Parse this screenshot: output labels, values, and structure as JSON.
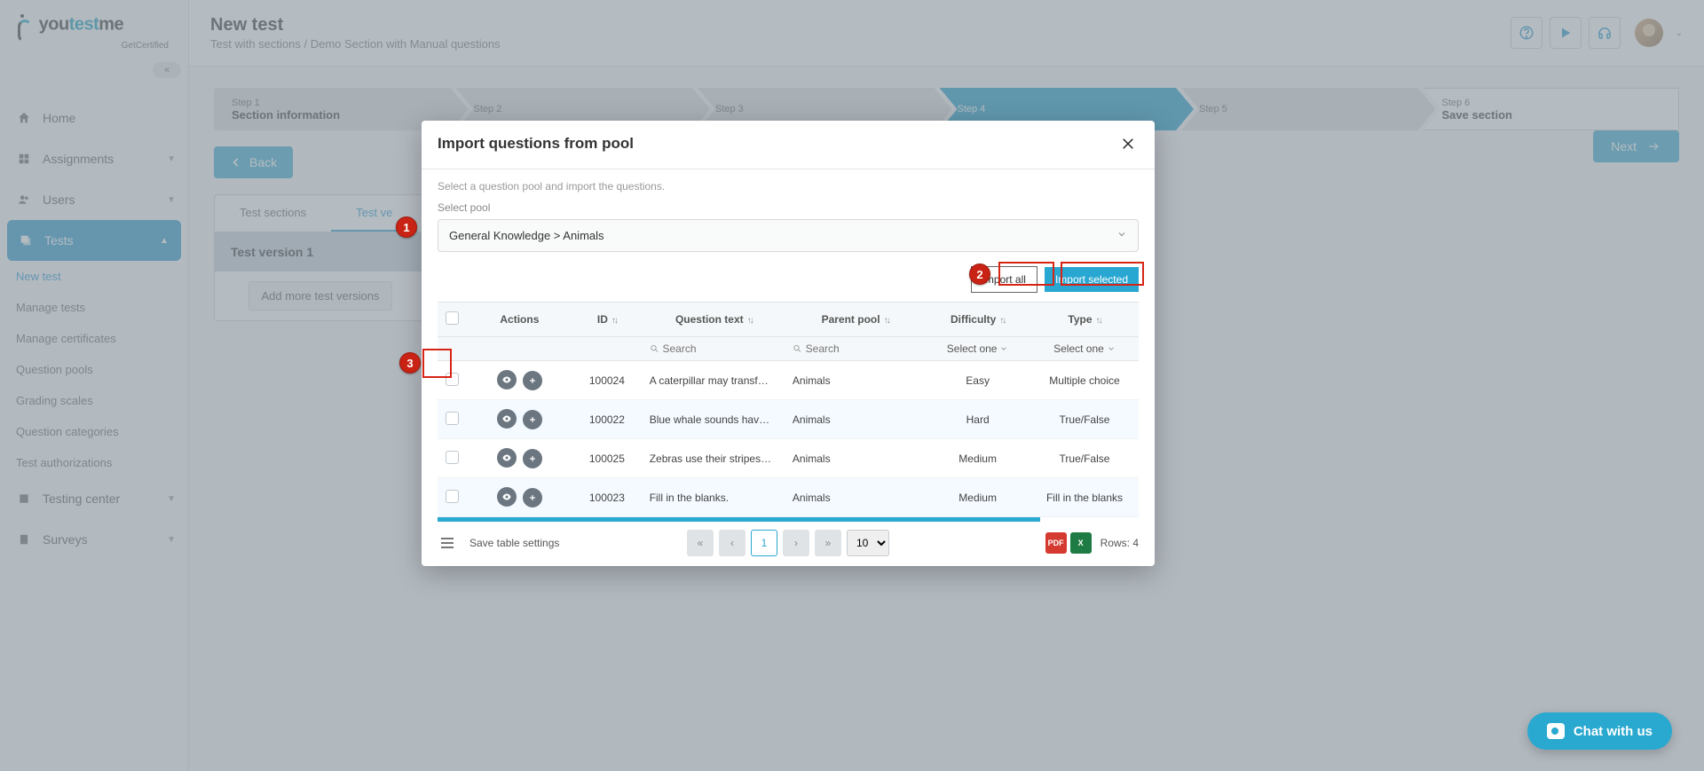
{
  "brand": {
    "prefix": "you",
    "mid": "test",
    "suffix": "me",
    "tagline": "GetCertified"
  },
  "sidebar": {
    "collapse": "«",
    "items": [
      {
        "label": "Home"
      },
      {
        "label": "Assignments",
        "caret": true
      },
      {
        "label": "Users",
        "caret": true
      },
      {
        "label": "Tests",
        "caret": true,
        "active": true
      },
      {
        "label": "Testing center",
        "caret": true
      },
      {
        "label": "Surveys",
        "caret": true
      }
    ],
    "tests_sub": [
      {
        "label": "New test",
        "highlight": true
      },
      {
        "label": "Manage tests"
      },
      {
        "label": "Manage certificates"
      },
      {
        "label": "Question pools"
      },
      {
        "label": "Grading scales"
      },
      {
        "label": "Question categories"
      },
      {
        "label": "Test authorizations"
      }
    ]
  },
  "header": {
    "title": "New test",
    "subtitle": "Test with sections / Demo Section with Manual questions"
  },
  "steps": [
    {
      "num": "Step 1",
      "label": "Section information"
    },
    {
      "num": "Step 2",
      "label": ""
    },
    {
      "num": "Step 3",
      "label": ""
    },
    {
      "num": "Step 4",
      "label": ""
    },
    {
      "num": "Step 5",
      "label": ""
    },
    {
      "num": "Step 6",
      "label": "Save section"
    }
  ],
  "nav_buttons": {
    "back": "Back",
    "next": "Next"
  },
  "tabs": {
    "sections": "Test sections",
    "versions": "Test ve",
    "version_title": "Test version 1",
    "add": "Add more test versions"
  },
  "modal": {
    "title": "Import questions from pool",
    "info": "Select a question pool and import the questions.",
    "pool_label": "Select pool",
    "pool_value": "General Knowledge > Animals",
    "import_all": "Import all",
    "import_selected": "Import selected",
    "columns": {
      "actions": "Actions",
      "id": "ID",
      "question": "Question text",
      "parent": "Parent pool",
      "difficulty": "Difficulty",
      "type": "Type"
    },
    "search_placeholder": "Search",
    "select_one": "Select one",
    "rows": [
      {
        "id": "100024",
        "question": "A caterpillar may transf…",
        "parent": "Animals",
        "difficulty": "Easy",
        "type": "Multiple choice"
      },
      {
        "id": "100022",
        "question": "Blue whale sounds hav…",
        "parent": "Animals",
        "difficulty": "Hard",
        "type": "True/False"
      },
      {
        "id": "100025",
        "question": "Zebras use their stripes…",
        "parent": "Animals",
        "difficulty": "Medium",
        "type": "True/False"
      },
      {
        "id": "100023",
        "question": "Fill in the blanks.",
        "parent": "Animals",
        "difficulty": "Medium",
        "type": "Fill in the blanks"
      }
    ],
    "footer": {
      "save": "Save table settings",
      "page": "1",
      "per_page": "10",
      "rows": "Rows: 4"
    }
  },
  "callouts": {
    "1": "1",
    "2": "2",
    "3": "3"
  },
  "chat": "Chat with us"
}
